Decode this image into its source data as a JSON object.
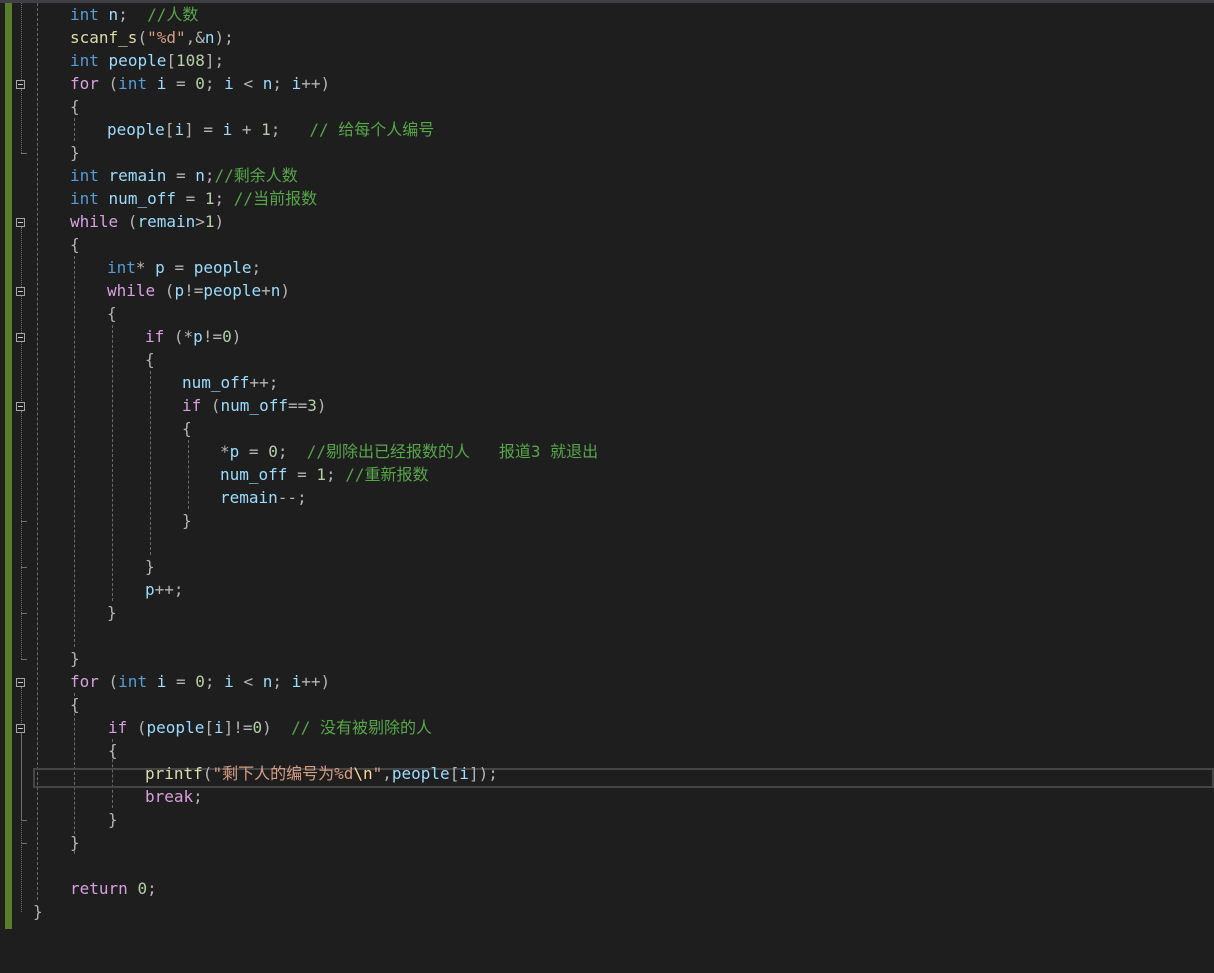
{
  "editor": {
    "lines": [
      {
        "tokens": [
          {
            "t": "kw",
            "v": "int"
          },
          {
            "t": "pun",
            "v": " "
          },
          {
            "t": "var",
            "v": "n"
          },
          {
            "t": "pun",
            "v": ";  "
          },
          {
            "t": "cmt",
            "v": "//人数"
          }
        ]
      },
      {
        "tokens": [
          {
            "t": "fn",
            "v": "scanf_s"
          },
          {
            "t": "pun",
            "v": "("
          },
          {
            "t": "str",
            "v": "\"%d\""
          },
          {
            "t": "pun",
            "v": ",&"
          },
          {
            "t": "var",
            "v": "n"
          },
          {
            "t": "pun",
            "v": ");"
          }
        ]
      },
      {
        "tokens": [
          {
            "t": "kw",
            "v": "int"
          },
          {
            "t": "pun",
            "v": " "
          },
          {
            "t": "var",
            "v": "people"
          },
          {
            "t": "pun",
            "v": "["
          },
          {
            "t": "num",
            "v": "108"
          },
          {
            "t": "pun",
            "v": "];"
          }
        ]
      },
      {
        "tokens": [
          {
            "t": "ctl",
            "v": "for"
          },
          {
            "t": "pun",
            "v": " ("
          },
          {
            "t": "kw",
            "v": "int"
          },
          {
            "t": "pun",
            "v": " "
          },
          {
            "t": "var",
            "v": "i"
          },
          {
            "t": "pun",
            "v": " = "
          },
          {
            "t": "num",
            "v": "0"
          },
          {
            "t": "pun",
            "v": "; "
          },
          {
            "t": "var",
            "v": "i"
          },
          {
            "t": "pun",
            "v": " < "
          },
          {
            "t": "var",
            "v": "n"
          },
          {
            "t": "pun",
            "v": "; "
          },
          {
            "t": "var",
            "v": "i"
          },
          {
            "t": "pun",
            "v": "++)"
          }
        ]
      },
      {
        "tokens": [
          {
            "t": "pun",
            "v": "{"
          }
        ]
      },
      {
        "tokens": [
          {
            "t": "var",
            "v": "people"
          },
          {
            "t": "pun",
            "v": "["
          },
          {
            "t": "var",
            "v": "i"
          },
          {
            "t": "pun",
            "v": "] = "
          },
          {
            "t": "var",
            "v": "i"
          },
          {
            "t": "pun",
            "v": " + "
          },
          {
            "t": "num",
            "v": "1"
          },
          {
            "t": "pun",
            "v": ";   "
          },
          {
            "t": "cmt",
            "v": "// 给每个人编号"
          }
        ]
      },
      {
        "tokens": [
          {
            "t": "pun",
            "v": "}"
          }
        ]
      },
      {
        "tokens": [
          {
            "t": "kw",
            "v": "int"
          },
          {
            "t": "pun",
            "v": " "
          },
          {
            "t": "var",
            "v": "remain"
          },
          {
            "t": "pun",
            "v": " = "
          },
          {
            "t": "var",
            "v": "n"
          },
          {
            "t": "pun",
            "v": ";"
          },
          {
            "t": "cmt",
            "v": "//剩余人数"
          }
        ]
      },
      {
        "tokens": [
          {
            "t": "kw",
            "v": "int"
          },
          {
            "t": "pun",
            "v": " "
          },
          {
            "t": "var",
            "v": "num_off"
          },
          {
            "t": "pun",
            "v": " = "
          },
          {
            "t": "num",
            "v": "1"
          },
          {
            "t": "pun",
            "v": "; "
          },
          {
            "t": "cmt",
            "v": "//当前报数"
          }
        ]
      },
      {
        "tokens": [
          {
            "t": "ctl",
            "v": "while"
          },
          {
            "t": "pun",
            "v": " ("
          },
          {
            "t": "var",
            "v": "remain"
          },
          {
            "t": "pun",
            "v": ">"
          },
          {
            "t": "num",
            "v": "1"
          },
          {
            "t": "pun",
            "v": ")"
          }
        ]
      },
      {
        "tokens": [
          {
            "t": "pun",
            "v": "{"
          }
        ]
      },
      {
        "tokens": [
          {
            "t": "kw",
            "v": "int"
          },
          {
            "t": "pun",
            "v": "* "
          },
          {
            "t": "var",
            "v": "p"
          },
          {
            "t": "pun",
            "v": " = "
          },
          {
            "t": "var",
            "v": "people"
          },
          {
            "t": "pun",
            "v": ";"
          }
        ]
      },
      {
        "tokens": [
          {
            "t": "ctl",
            "v": "while"
          },
          {
            "t": "pun",
            "v": " ("
          },
          {
            "t": "var",
            "v": "p"
          },
          {
            "t": "pun",
            "v": "!="
          },
          {
            "t": "var",
            "v": "people"
          },
          {
            "t": "pun",
            "v": "+"
          },
          {
            "t": "var",
            "v": "n"
          },
          {
            "t": "pun",
            "v": ")"
          }
        ]
      },
      {
        "tokens": [
          {
            "t": "pun",
            "v": "{"
          }
        ]
      },
      {
        "tokens": [
          {
            "t": "ctl",
            "v": "if"
          },
          {
            "t": "pun",
            "v": " (*"
          },
          {
            "t": "var",
            "v": "p"
          },
          {
            "t": "pun",
            "v": "!="
          },
          {
            "t": "num",
            "v": "0"
          },
          {
            "t": "pun",
            "v": ")"
          }
        ]
      },
      {
        "tokens": [
          {
            "t": "pun",
            "v": "{"
          }
        ]
      },
      {
        "tokens": [
          {
            "t": "var",
            "v": "num_off"
          },
          {
            "t": "pun",
            "v": "++;"
          }
        ]
      },
      {
        "tokens": [
          {
            "t": "ctl",
            "v": "if"
          },
          {
            "t": "pun",
            "v": " ("
          },
          {
            "t": "var",
            "v": "num_off"
          },
          {
            "t": "pun",
            "v": "=="
          },
          {
            "t": "num",
            "v": "3"
          },
          {
            "t": "pun",
            "v": ")"
          }
        ]
      },
      {
        "tokens": [
          {
            "t": "pun",
            "v": "{"
          }
        ]
      },
      {
        "tokens": [
          {
            "t": "pun",
            "v": "*"
          },
          {
            "t": "var",
            "v": "p"
          },
          {
            "t": "pun",
            "v": " = "
          },
          {
            "t": "num",
            "v": "0"
          },
          {
            "t": "pun",
            "v": ";  "
          },
          {
            "t": "cmt",
            "v": "//剔除出已经报数的人   报道3 就退出"
          }
        ]
      },
      {
        "tokens": [
          {
            "t": "var",
            "v": "num_off"
          },
          {
            "t": "pun",
            "v": " = "
          },
          {
            "t": "num",
            "v": "1"
          },
          {
            "t": "pun",
            "v": "; "
          },
          {
            "t": "cmt",
            "v": "//重新报数"
          }
        ]
      },
      {
        "tokens": [
          {
            "t": "var",
            "v": "remain"
          },
          {
            "t": "pun",
            "v": "--;"
          }
        ]
      },
      {
        "tokens": [
          {
            "t": "pun",
            "v": "}"
          }
        ]
      },
      {
        "tokens": []
      },
      {
        "tokens": [
          {
            "t": "pun",
            "v": "}"
          }
        ]
      },
      {
        "tokens": [
          {
            "t": "var",
            "v": "p"
          },
          {
            "t": "pun",
            "v": "++;"
          }
        ]
      },
      {
        "tokens": [
          {
            "t": "pun",
            "v": "}"
          }
        ]
      },
      {
        "tokens": []
      },
      {
        "tokens": [
          {
            "t": "pun",
            "v": "}"
          }
        ]
      },
      {
        "tokens": [
          {
            "t": "ctl",
            "v": "for"
          },
          {
            "t": "pun",
            "v": " ("
          },
          {
            "t": "kw",
            "v": "int"
          },
          {
            "t": "pun",
            "v": " "
          },
          {
            "t": "var",
            "v": "i"
          },
          {
            "t": "pun",
            "v": " = "
          },
          {
            "t": "num",
            "v": "0"
          },
          {
            "t": "pun",
            "v": "; "
          },
          {
            "t": "var",
            "v": "i"
          },
          {
            "t": "pun",
            "v": " < "
          },
          {
            "t": "var",
            "v": "n"
          },
          {
            "t": "pun",
            "v": "; "
          },
          {
            "t": "var",
            "v": "i"
          },
          {
            "t": "pun",
            "v": "++)"
          }
        ]
      },
      {
        "tokens": [
          {
            "t": "pun",
            "v": "{"
          }
        ]
      },
      {
        "tokens": [
          {
            "t": "ctl",
            "v": "if"
          },
          {
            "t": "pun",
            "v": " ("
          },
          {
            "t": "var",
            "v": "people"
          },
          {
            "t": "pun",
            "v": "["
          },
          {
            "t": "var",
            "v": "i"
          },
          {
            "t": "pun",
            "v": "]!="
          },
          {
            "t": "num",
            "v": "0"
          },
          {
            "t": "pun",
            "v": ")  "
          },
          {
            "t": "cmt",
            "v": "// 没有被剔除的人"
          }
        ]
      },
      {
        "tokens": [
          {
            "t": "pun",
            "v": "{"
          }
        ]
      },
      {
        "tokens": [
          {
            "t": "fn",
            "v": "printf"
          },
          {
            "t": "pun",
            "v": "("
          },
          {
            "t": "str",
            "v": "\"剩下人的编号为%d"
          },
          {
            "t": "esc",
            "v": "\\n"
          },
          {
            "t": "str",
            "v": "\""
          },
          {
            "t": "pun",
            "v": ","
          },
          {
            "t": "var",
            "v": "people"
          },
          {
            "t": "pun",
            "v": "["
          },
          {
            "t": "var",
            "v": "i"
          },
          {
            "t": "pun",
            "v": "]);"
          }
        ]
      },
      {
        "tokens": [
          {
            "t": "ctl",
            "v": "break"
          },
          {
            "t": "pun",
            "v": ";"
          }
        ]
      },
      {
        "tokens": [
          {
            "t": "pun",
            "v": "}"
          }
        ]
      },
      {
        "tokens": [
          {
            "t": "pun",
            "v": "}"
          }
        ]
      },
      {
        "tokens": []
      },
      {
        "tokens": [
          {
            "t": "ctl",
            "v": "return"
          },
          {
            "t": "pun",
            "v": " "
          },
          {
            "t": "num",
            "v": "0"
          },
          {
            "t": "pun",
            "v": ";"
          }
        ]
      },
      {
        "tokens": [
          {
            "t": "pun",
            "v": "}"
          }
        ]
      }
    ]
  }
}
